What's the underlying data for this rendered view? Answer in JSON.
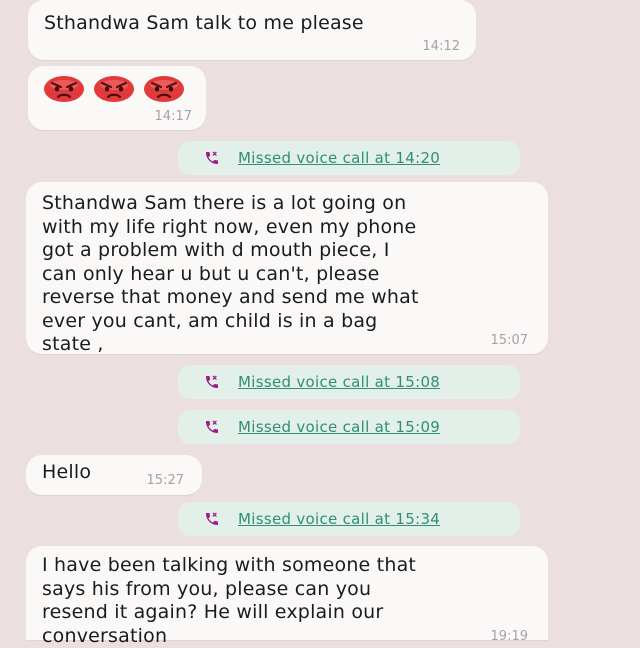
{
  "messages": [
    {
      "text": "Sthandwa Sam talk to me please",
      "time": "14:12"
    },
    {
      "emojis": [
        "angry-face-emoji",
        "angry-face-emoji",
        "angry-face-emoji"
      ],
      "time": "14:17"
    },
    {
      "text": "Sthandwa Sam there is a lot going on\nwith my life right now, even my phone\ngot a problem with d mouth piece, I\ncan only hear u but u can't, please\nreverse that money and send me what\never you cant, am child is in a bag\nstate ,",
      "time": "15:07"
    },
    {
      "text": "Hello",
      "time": "15:27"
    },
    {
      "text": "I have been talking with someone that\nsays his from you, please can you\nresend it again? He will explain our\nconversation",
      "time": "19:19"
    }
  ],
  "missed_calls": [
    {
      "label": "Missed voice call at 14:20",
      "icon": "phone-missed-icon"
    },
    {
      "label": "Missed voice call at 15:08",
      "icon": "phone-missed-icon"
    },
    {
      "label": "Missed voice call at 15:09",
      "icon": "phone-missed-icon"
    },
    {
      "label": "Missed voice call at 15:34",
      "icon": "phone-missed-icon"
    }
  ],
  "colors": {
    "background": "#ecdfe1",
    "bubble": "#fbf8f8",
    "call_pill": "#e3efe9",
    "call_text": "#2f8f77",
    "call_icon": "#a0188a",
    "emoji_red": "#e23a3a"
  }
}
